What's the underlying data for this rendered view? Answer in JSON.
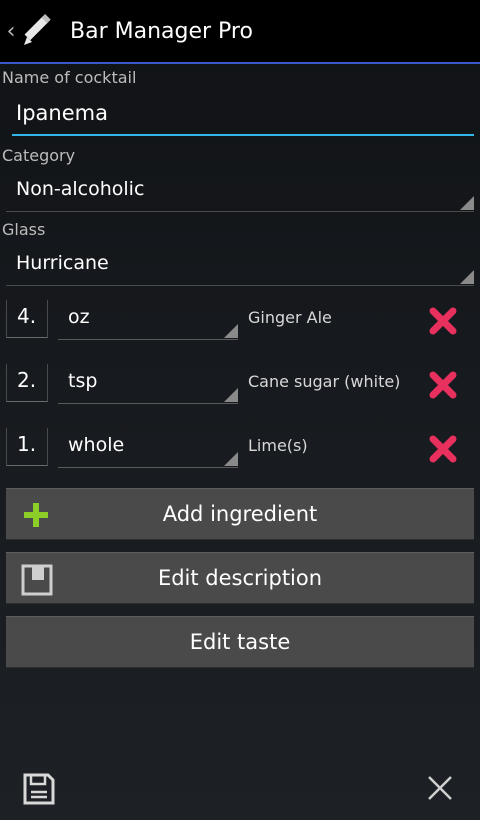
{
  "app": {
    "title": "Bar Manager Pro",
    "back_icon": "chevron-left-icon",
    "app_icon": "pencil-icon"
  },
  "form": {
    "name_label": "Name of cocktail",
    "name_value": "Ipanema",
    "category_label": "Category",
    "category_value": "Non-alcoholic",
    "glass_label": "Glass",
    "glass_value": "Hurricane"
  },
  "ingredients": [
    {
      "qty": "4.",
      "unit": "oz",
      "name": "Ginger Ale"
    },
    {
      "qty": "2.",
      "unit": "tsp",
      "name": "Cane sugar (white)"
    },
    {
      "qty": "1.",
      "unit": "whole",
      "name": "Lime(s)"
    }
  ],
  "buttons": {
    "add_ingredient": "Add ingredient",
    "edit_description": "Edit description",
    "edit_taste": "Edit taste"
  },
  "colors": {
    "accent": "#33b5e5",
    "delete": "#e8305e",
    "add": "#8ccd28",
    "actionbar_line": "#3a5bd0"
  },
  "bottom": {
    "save_icon": "save-icon",
    "close_icon": "close-icon"
  }
}
